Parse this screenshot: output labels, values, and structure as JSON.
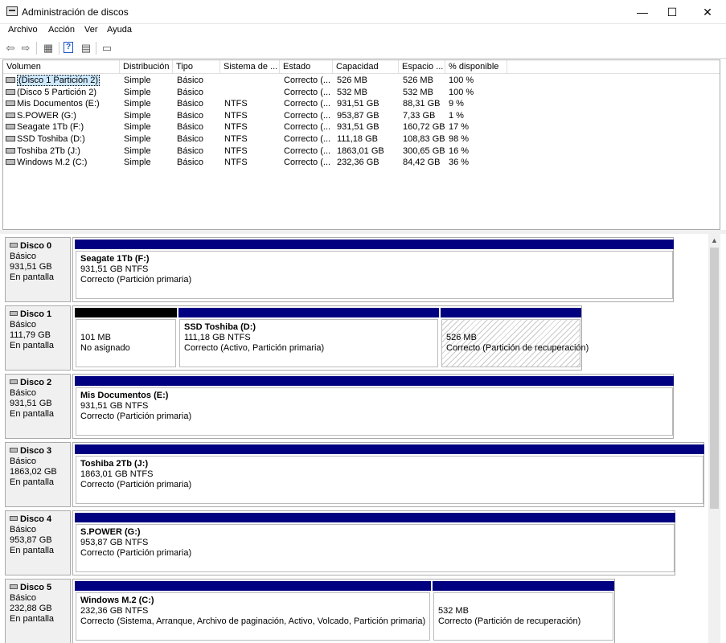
{
  "window": {
    "title": "Administración de discos",
    "minimize": "—",
    "maximize": "☐",
    "close": "✕"
  },
  "menu": [
    "Archivo",
    "Acción",
    "Ver",
    "Ayuda"
  ],
  "toolbar": {
    "back": "⇦",
    "forward": "⇨",
    "icon3": "▦",
    "help": "?",
    "icon5": "▤",
    "icon6": "▭"
  },
  "columns": [
    "Volumen",
    "Distribución",
    "Tipo",
    "Sistema de ...",
    "Estado",
    "Capacidad",
    "Espacio ...",
    "% disponible"
  ],
  "volumes": [
    [
      "(Disco 1 Partición 2)",
      "Simple",
      "Básico",
      "",
      "Correcto (...",
      "526 MB",
      "526 MB",
      "100 %"
    ],
    [
      "(Disco 5 Partición 2)",
      "Simple",
      "Básico",
      "",
      "Correcto (...",
      "532 MB",
      "532 MB",
      "100 %"
    ],
    [
      "Mis Documentos (E:)",
      "Simple",
      "Básico",
      "NTFS",
      "Correcto (...",
      "931,51 GB",
      "88,31 GB",
      "9 %"
    ],
    [
      "S.POWER (G:)",
      "Simple",
      "Básico",
      "NTFS",
      "Correcto (...",
      "953,87 GB",
      "7,33 GB",
      "1 %"
    ],
    [
      "Seagate 1Tb (F:)",
      "Simple",
      "Básico",
      "NTFS",
      "Correcto (...",
      "931,51 GB",
      "160,72 GB",
      "17 %"
    ],
    [
      "SSD Toshiba (D:)",
      "Simple",
      "Básico",
      "NTFS",
      "Correcto (...",
      "111,18 GB",
      "108,83 GB",
      "98 %"
    ],
    [
      "Toshiba 2Tb (J:)",
      "Simple",
      "Básico",
      "NTFS",
      "Correcto (...",
      "1863,01 GB",
      "300,65 GB",
      "16 %"
    ],
    [
      "Windows M.2 (C:)",
      "Simple",
      "Básico",
      "NTFS",
      "Correcto (...",
      "232,36 GB",
      "84,42 GB",
      "36 %"
    ]
  ],
  "disks": [
    {
      "name": "Disco 0",
      "type": "Básico",
      "size": "931,51 GB",
      "state": "En pantalla",
      "partitions": [
        {
          "title": "Seagate 1Tb  (F:)",
          "line1": "931,51 GB NTFS",
          "line2": "Correcto (Partición primaria)"
        }
      ]
    },
    {
      "name": "Disco 1",
      "type": "Básico",
      "size": "111,79 GB",
      "state": "En pantalla",
      "partitions": [
        {
          "title": "",
          "line1": "101 MB",
          "line2": "No asignado"
        },
        {
          "title": "SSD Toshiba  (D:)",
          "line1": "111,18 GB NTFS",
          "line2": "Correcto (Activo, Partición primaria)"
        },
        {
          "title": "",
          "line1": "526 MB",
          "line2": "Correcto (Partición de recuperación)"
        }
      ]
    },
    {
      "name": "Disco 2",
      "type": "Básico",
      "size": "931,51 GB",
      "state": "En pantalla",
      "partitions": [
        {
          "title": "Mis Documentos  (E:)",
          "line1": "931,51 GB NTFS",
          "line2": "Correcto (Partición primaria)"
        }
      ]
    },
    {
      "name": "Disco 3",
      "type": "Básico",
      "size": "1863,02 GB",
      "state": "En pantalla",
      "partitions": [
        {
          "title": "Toshiba 2Tb  (J:)",
          "line1": "1863,01 GB NTFS",
          "line2": "Correcto (Partición primaria)"
        }
      ]
    },
    {
      "name": "Disco 4",
      "type": "Básico",
      "size": "953,87 GB",
      "state": "En pantalla",
      "partitions": [
        {
          "title": "S.POWER  (G:)",
          "line1": "953,87 GB NTFS",
          "line2": "Correcto (Partición primaria)"
        }
      ]
    },
    {
      "name": "Disco 5",
      "type": "Básico",
      "size": "232,88 GB",
      "state": "En pantalla",
      "partitions": [
        {
          "title": "Windows M.2  (C:)",
          "line1": "232,36 GB NTFS",
          "line2": "Correcto (Sistema, Arranque, Archivo de paginación, Activo, Volcado, Partición primaria)"
        },
        {
          "title": "",
          "line1": "532 MB",
          "line2": "Correcto (Partición de recuperación)"
        }
      ]
    }
  ]
}
